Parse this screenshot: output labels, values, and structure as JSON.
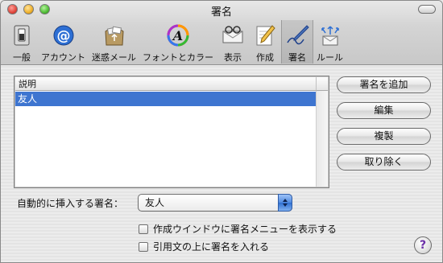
{
  "window": {
    "title": "署名"
  },
  "toolbar": {
    "items": [
      {
        "label": "一般",
        "icon": "switch-icon"
      },
      {
        "label": "アカウント",
        "icon": "at-sign-icon"
      },
      {
        "label": "迷惑メール",
        "icon": "junk-mail-bag-icon"
      },
      {
        "label": "フォントとカラー",
        "icon": "font-color-icon"
      },
      {
        "label": "表示",
        "icon": "viewing-icon"
      },
      {
        "label": "作成",
        "icon": "composing-pencil-icon"
      },
      {
        "label": "署名",
        "icon": "signature-pen-icon",
        "active": true
      },
      {
        "label": "ルール",
        "icon": "rules-icon"
      }
    ]
  },
  "signatures": {
    "header": "説明",
    "rows": [
      "友人"
    ],
    "selected_index": 0
  },
  "buttons": {
    "add": "署名を追加",
    "edit": "編集",
    "duplicate": "複製",
    "remove": "取り除く"
  },
  "auto_insert": {
    "label": "自動的に挿入する署名：",
    "value": "友人"
  },
  "options": {
    "show_menu": "作成ウインドウに署名メニューを表示する",
    "above_quote": "引用文の上に署名を入れる"
  },
  "help": {
    "label": "?"
  },
  "colors": {
    "selection": "#3e75d0",
    "accent": "#4f8ae0"
  }
}
